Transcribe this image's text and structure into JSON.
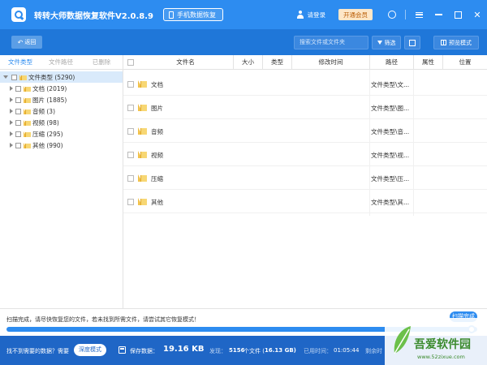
{
  "app": {
    "title": "转转大师数据恢复软件V2.0.8.9",
    "phone_recovery_label": "手机数据恢复",
    "login_label": "请登录",
    "vip_label": "开通会员"
  },
  "toolbar": {
    "back_label": "返回",
    "search_placeholder": "搜索文件或文件夹",
    "filter_label": "筛选",
    "preview_label": "预览模式"
  },
  "left_panel": {
    "tabs": [
      "文件类型",
      "文件路径",
      "已删除"
    ],
    "active_tab": 0,
    "tree": {
      "root": "文件类型 (5290)",
      "children": [
        "文档 (2019)",
        "图片 (1885)",
        "音频 (3)",
        "视频 (98)",
        "压缩 (295)",
        "其他 (990)"
      ]
    }
  },
  "file_table": {
    "columns": [
      "文件名",
      "大小",
      "类型",
      "修改时间",
      "路径",
      "属性",
      "位置"
    ],
    "rows": [
      {
        "name": "文档",
        "path": "文件类型\\文..."
      },
      {
        "name": "图片",
        "path": "文件类型\\图..."
      },
      {
        "name": "音频",
        "path": "文件类型\\音..."
      },
      {
        "name": "视频",
        "path": "文件类型\\视..."
      },
      {
        "name": "压缩",
        "path": "文件类型\\压..."
      },
      {
        "name": "其他",
        "path": "文件类型\\其..."
      }
    ]
  },
  "status": {
    "message": "扫描完成，请尽快恢复您的文件，若未找到所需文件，请尝试其它恢复模式！",
    "badge": "扫描完成",
    "progress": 1.0
  },
  "bottom": {
    "need_text": "找不到需要的数据？需要",
    "deep_scan_label": "深度模式",
    "save_label": "保存数据：",
    "save_size": "19.16 KB",
    "found_label": "发现：",
    "found_count": "5156",
    "found_unit": "个文件 (",
    "found_size": "16.13 GB)",
    "time_label": "已用时间：",
    "time_value": "01:05:44",
    "remain_label": "剩余时"
  },
  "watermark": {
    "title": "吾爱软件园",
    "url": "www.52zixue.com"
  },
  "colors": {
    "title_bar": "#2d8cf0",
    "toolbar": "#1f77d9",
    "bottom_bar": "#1f66c6",
    "selection": "#d9eafb",
    "vip_bg": "#fde7c8"
  }
}
